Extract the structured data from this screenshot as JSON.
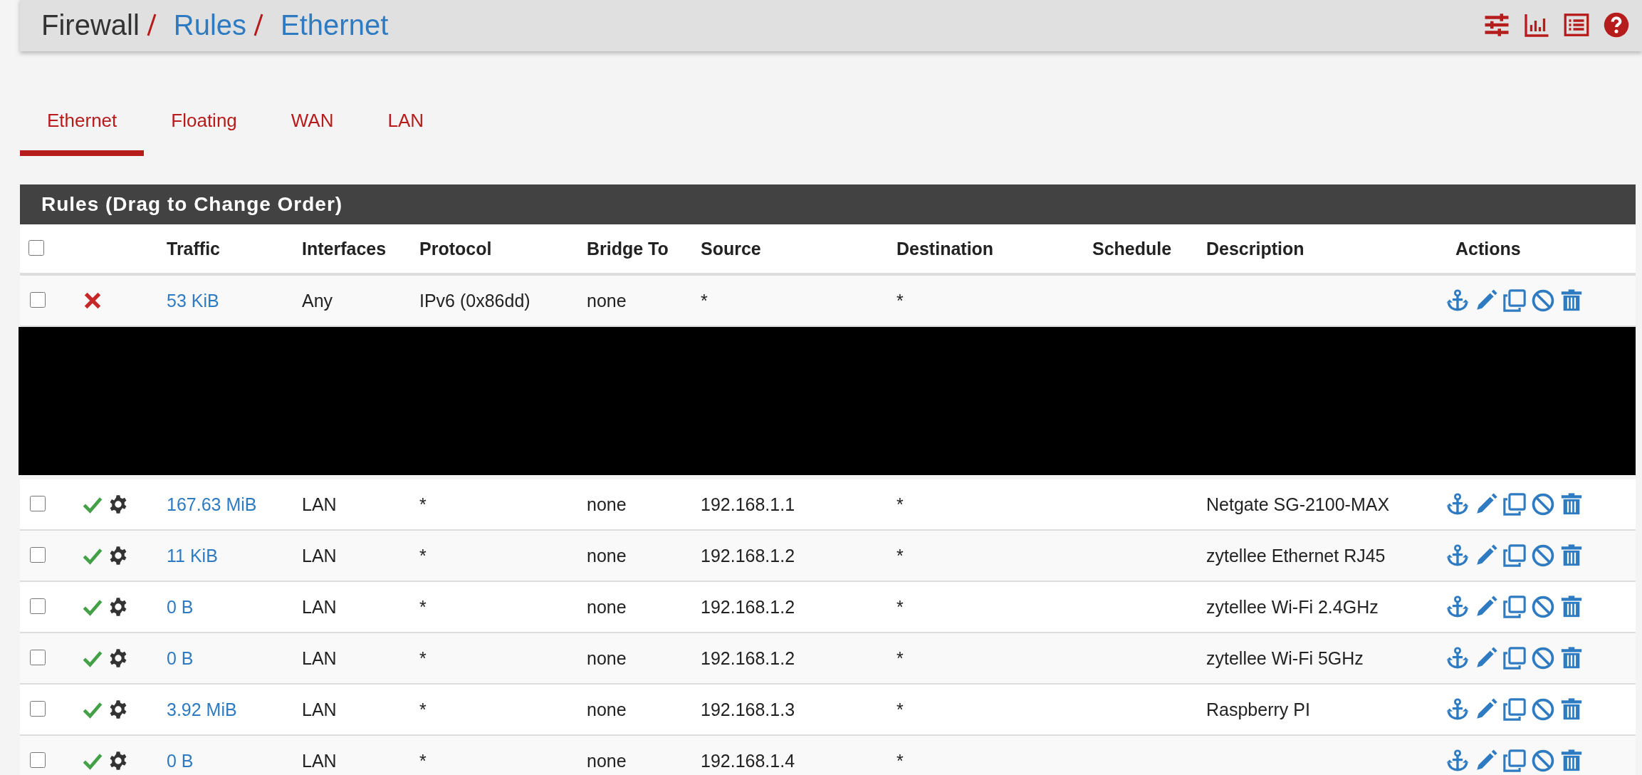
{
  "breadcrumb": [
    {
      "label": "Firewall",
      "link": false
    },
    {
      "label": "Rules",
      "link": true
    },
    {
      "label": "Ethernet",
      "link": true
    }
  ],
  "tabs": [
    {
      "label": "Ethernet",
      "selected": true
    },
    {
      "label": "Floating",
      "selected": false
    },
    {
      "label": "WAN",
      "selected": false
    },
    {
      "label": "LAN",
      "selected": false
    }
  ],
  "panel": {
    "title": "Rules (Drag to Change Order)"
  },
  "table": {
    "select_all": {
      "checked": false
    },
    "columns": [
      "Traffic",
      "Interfaces",
      "Protocol",
      "Bridge To",
      "Source",
      "Destination",
      "Schedule",
      "Description",
      "Actions"
    ],
    "rows": [
      {
        "kind": "rule",
        "checked": false,
        "blocked": true,
        "advanced": false,
        "traffic": "53 KiB",
        "interfaces": "Any",
        "protocol": "IPv6 (0x86dd)",
        "bridge_to": "none",
        "source": "*",
        "destination": "*",
        "description": ""
      },
      {
        "kind": "redacted"
      },
      {
        "kind": "rule",
        "checked": false,
        "blocked": false,
        "advanced": true,
        "traffic": "167.63 MiB",
        "interfaces": "LAN",
        "protocol": "*",
        "bridge_to": "none",
        "source": "192.168.1.1",
        "destination": "*",
        "description": "Netgate SG-2100-MAX"
      },
      {
        "kind": "rule",
        "checked": false,
        "blocked": false,
        "advanced": true,
        "traffic": "11 KiB",
        "interfaces": "LAN",
        "protocol": "*",
        "bridge_to": "none",
        "source": "192.168.1.2",
        "destination": "*",
        "description": "zytellee Ethernet RJ45"
      },
      {
        "kind": "rule",
        "checked": false,
        "blocked": false,
        "advanced": true,
        "traffic": "0 B",
        "interfaces": "LAN",
        "protocol": "*",
        "bridge_to": "none",
        "source": "192.168.1.2",
        "destination": "*",
        "description": "zytellee Wi-Fi 2.4GHz"
      },
      {
        "kind": "rule",
        "checked": false,
        "blocked": false,
        "advanced": true,
        "traffic": "0 B",
        "interfaces": "LAN",
        "protocol": "*",
        "bridge_to": "none",
        "source": "192.168.1.2",
        "destination": "*",
        "description": "zytellee Wi-Fi 5GHz"
      },
      {
        "kind": "rule",
        "checked": false,
        "blocked": false,
        "advanced": true,
        "traffic": "3.92 MiB",
        "interfaces": "LAN",
        "protocol": "*",
        "bridge_to": "none",
        "source": "192.168.1.3",
        "destination": "*",
        "description": "Raspberry PI"
      },
      {
        "kind": "rule",
        "checked": false,
        "blocked": false,
        "advanced": true,
        "traffic": "0 B",
        "interfaces": "LAN",
        "protocol": "*",
        "bridge_to": "none",
        "source": "192.168.1.4",
        "destination": "*",
        "description": ""
      }
    ]
  }
}
